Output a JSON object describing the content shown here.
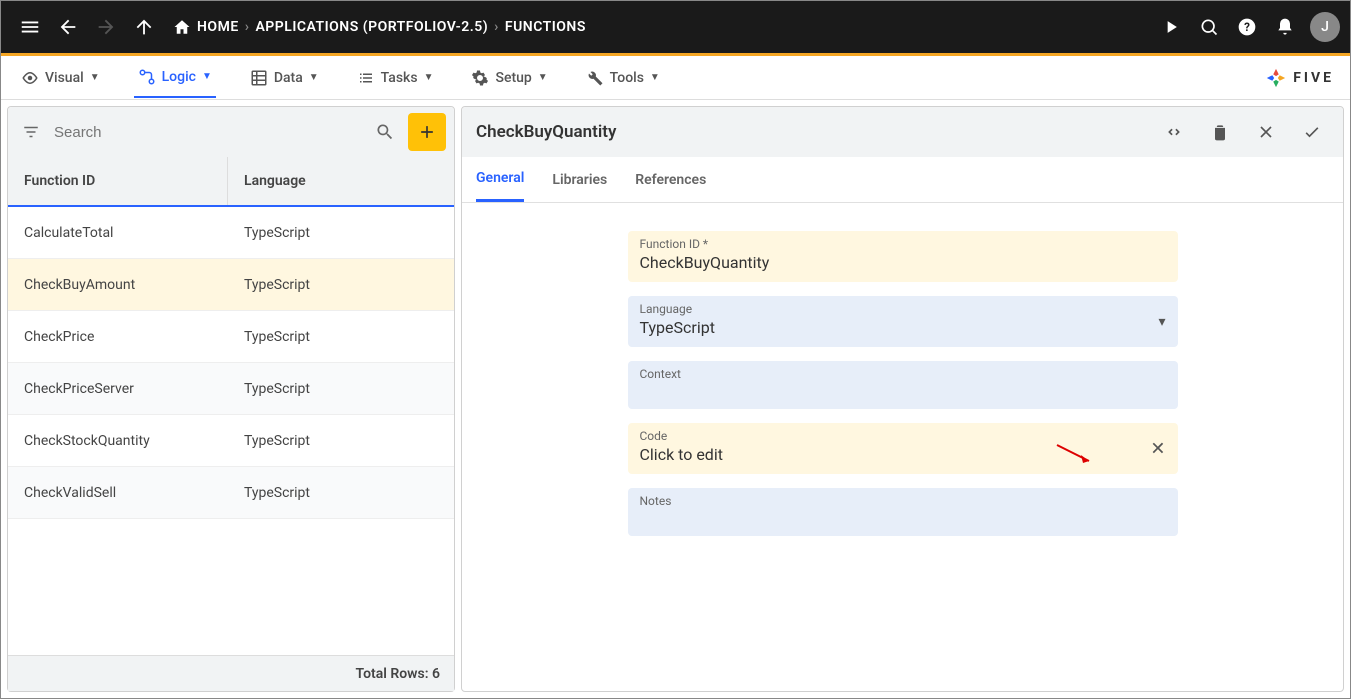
{
  "topbar": {
    "home_label": "HOME",
    "breadcrumb_app": "APPLICATIONS (PORTFOLIOV-2.5)",
    "breadcrumb_functions": "FUNCTIONS",
    "avatar_letter": "J"
  },
  "menubar": {
    "visual": "Visual",
    "logic": "Logic",
    "data": "Data",
    "tasks": "Tasks",
    "setup": "Setup",
    "tools": "Tools",
    "brand": "FIVE"
  },
  "leftPanel": {
    "search_placeholder": "Search",
    "columns": {
      "id": "Function ID",
      "lang": "Language"
    },
    "rows": [
      {
        "id": "CalculateTotal",
        "lang": "TypeScript"
      },
      {
        "id": "CheckBuyAmount",
        "lang": "TypeScript"
      },
      {
        "id": "CheckPrice",
        "lang": "TypeScript"
      },
      {
        "id": "CheckPriceServer",
        "lang": "TypeScript"
      },
      {
        "id": "CheckStockQuantity",
        "lang": "TypeScript"
      },
      {
        "id": "CheckValidSell",
        "lang": "TypeScript"
      }
    ],
    "footer": "Total Rows: 6"
  },
  "detail": {
    "title": "CheckBuyQuantity",
    "tabs": {
      "general": "General",
      "libraries": "Libraries",
      "references": "References"
    },
    "fields": {
      "functionId": {
        "label": "Function ID *",
        "value": "CheckBuyQuantity"
      },
      "language": {
        "label": "Language",
        "value": "TypeScript"
      },
      "context": {
        "label": "Context",
        "value": ""
      },
      "code": {
        "label": "Code",
        "value": "Click to edit"
      },
      "notes": {
        "label": "Notes",
        "value": ""
      }
    }
  }
}
